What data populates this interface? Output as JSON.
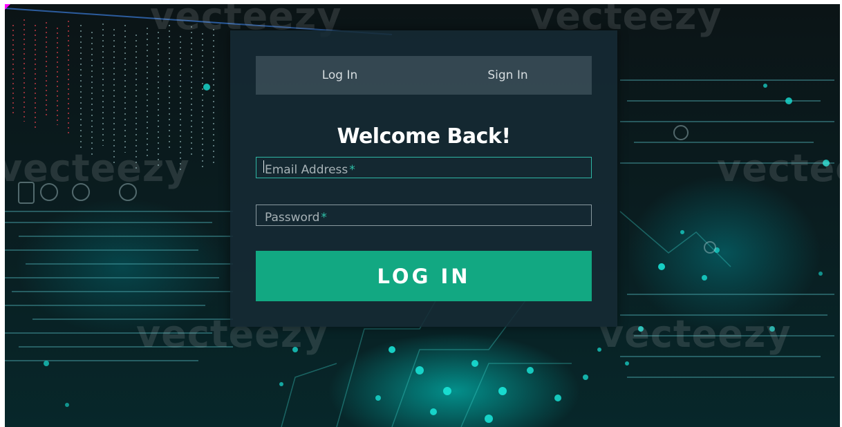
{
  "background": {
    "watermark_text": "vecteezy",
    "accent_color": "#19e0d4"
  },
  "auth_card": {
    "tabs": [
      {
        "label": "Log In"
      },
      {
        "label": "Sign In"
      }
    ],
    "title": "Welcome Back!",
    "email": {
      "label": "Email Address",
      "required_mark": "*",
      "value": ""
    },
    "password": {
      "label": "Password",
      "required_mark": "*",
      "value": ""
    },
    "submit_label": "LOG IN",
    "colors": {
      "card": "#162a34",
      "button": "#12a882",
      "focus_border": "#2fb8a6",
      "required": "#2fc0a8"
    }
  }
}
